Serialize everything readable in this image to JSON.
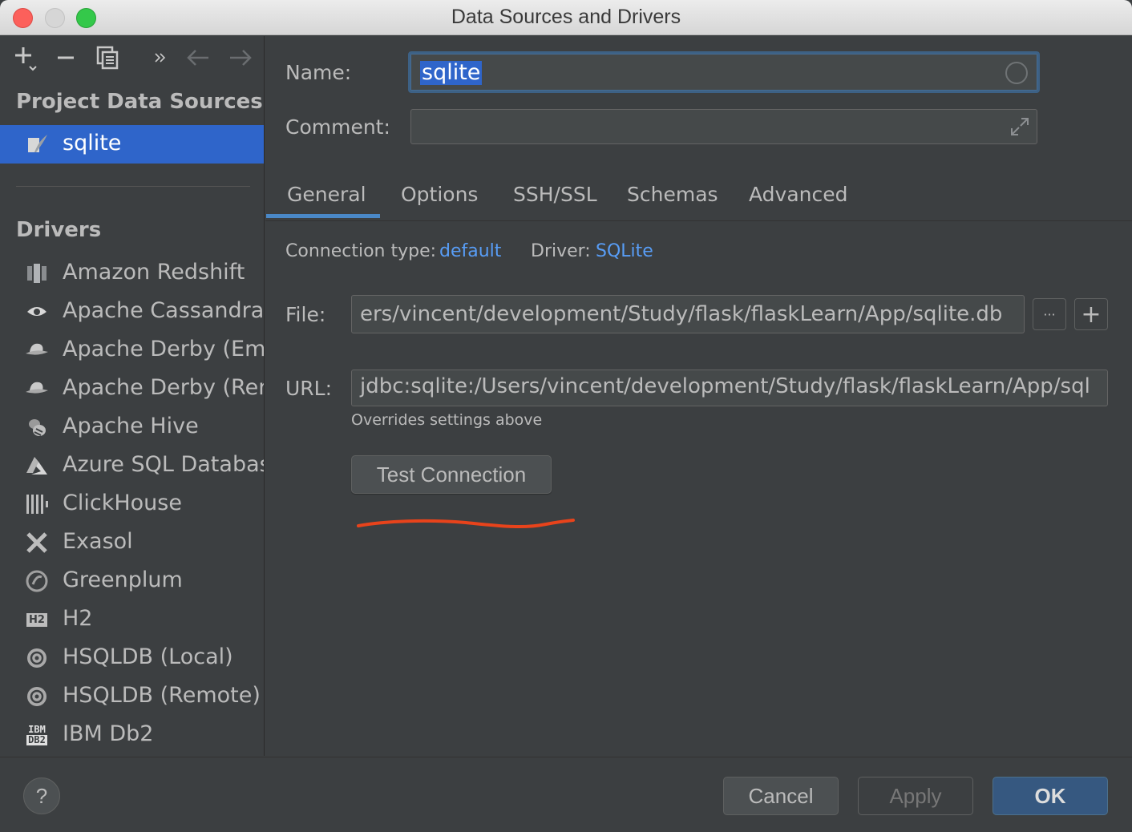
{
  "window": {
    "title": "Data Sources and Drivers"
  },
  "sidebar": {
    "project_section_title": "Project Data Sources",
    "data_sources": [
      {
        "label": "sqlite",
        "selected": true
      }
    ],
    "drivers_section_title": "Drivers",
    "drivers": [
      {
        "label": "Amazon Redshift",
        "icon": "redshift-icon"
      },
      {
        "label": "Apache Cassandra",
        "icon": "cassandra-eye-icon"
      },
      {
        "label": "Apache Derby (Embe",
        "icon": "derby-hat-icon"
      },
      {
        "label": "Apache Derby (Remo",
        "icon": "derby-hat-icon"
      },
      {
        "label": "Apache Hive",
        "icon": "hive-bee-icon"
      },
      {
        "label": "Azure SQL Database",
        "icon": "azure-icon"
      },
      {
        "label": "ClickHouse",
        "icon": "clickhouse-bars-icon"
      },
      {
        "label": "Exasol",
        "icon": "exasol-x-icon"
      },
      {
        "label": "Greenplum",
        "icon": "greenplum-icon"
      },
      {
        "label": "H2",
        "icon": "h2-icon",
        "icon_text": "H2"
      },
      {
        "label": "HSQLDB (Local)",
        "icon": "hsqldb-icon"
      },
      {
        "label": "HSQLDB (Remote)",
        "icon": "hsqldb-icon"
      },
      {
        "label": "IBM Db2",
        "icon": "ibm-db2-icon",
        "icon_text_top": "IBM",
        "icon_text_bottom": "DB2"
      }
    ]
  },
  "form": {
    "name_label": "Name:",
    "name_value": "sqlite",
    "comment_label": "Comment:",
    "comment_value": "",
    "tabs": [
      {
        "label": "General",
        "active": true
      },
      {
        "label": "Options"
      },
      {
        "label": "SSH/SSL"
      },
      {
        "label": "Schemas"
      },
      {
        "label": "Advanced"
      }
    ],
    "connection_type_label": "Connection type:",
    "connection_type_value": "default",
    "driver_label": "Driver:",
    "driver_value": "SQLite",
    "file_label": "File:",
    "file_value": "ers/vincent/development/Study/flask/flaskLearn/App/sqlite.db",
    "file_browse_label": "···",
    "file_add_label": "+",
    "url_label": "URL:",
    "url_value": "jdbc:sqlite:/Users/vincent/development/Study/flask/flaskLearn/App/sql",
    "url_hint": "Overrides settings above",
    "test_connection_label": "Test Connection"
  },
  "footer": {
    "help_label": "?",
    "cancel_label": "Cancel",
    "apply_label": "Apply",
    "ok_label": "OK"
  },
  "colors": {
    "selection": "#2f65ca",
    "link": "#589df6",
    "annotation": "#e8431b",
    "tab_underline": "#4a88c7"
  }
}
